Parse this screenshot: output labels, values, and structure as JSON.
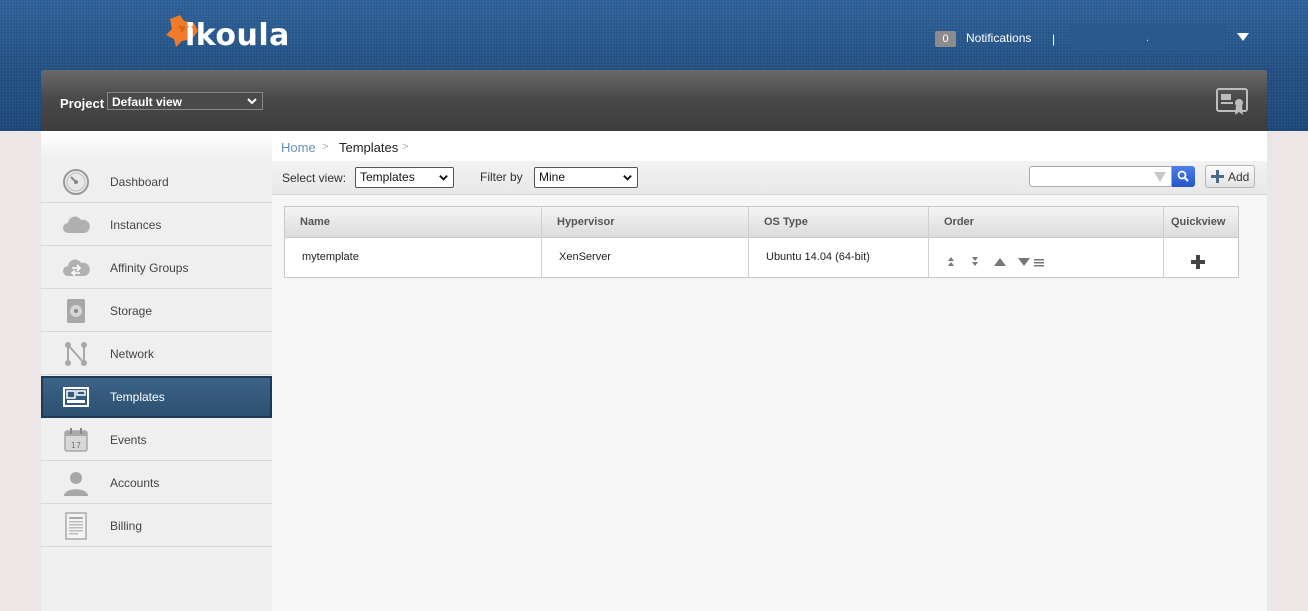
{
  "header": {
    "logo_text": "ikoula",
    "notifications": {
      "count": "0",
      "label": "Notifications",
      "separator": "|"
    },
    "user_name": "."
  },
  "toolbar": {
    "project_label": "Project",
    "project_selected": "Default view"
  },
  "sidebar": {
    "items": [
      {
        "label": "Dashboard",
        "icon": "dashboard-gauge-icon"
      },
      {
        "label": "Instances",
        "icon": "cloud-icon"
      },
      {
        "label": "Affinity Groups",
        "icon": "cloud-arrows-icon"
      },
      {
        "label": "Storage",
        "icon": "hard-disk-icon"
      },
      {
        "label": "Network",
        "icon": "network-nodes-icon"
      },
      {
        "label": "Templates",
        "icon": "templates-icon",
        "active": true
      },
      {
        "label": "Events",
        "icon": "calendar-icon"
      },
      {
        "label": "Accounts",
        "icon": "user-icon"
      },
      {
        "label": "Billing",
        "icon": "invoice-icon"
      }
    ]
  },
  "breadcrumb": {
    "home": "Home",
    "current": "Templates",
    "separator": ">"
  },
  "filters": {
    "select_view_label": "Select view:",
    "select_view_value": "Templates",
    "filter_by_label": "Filter by",
    "filter_by_value": "Mine",
    "search_value": "",
    "add_label": "Add"
  },
  "table": {
    "columns": [
      "Name",
      "Hypervisor",
      "OS Type",
      "Order",
      "Quickview"
    ],
    "rows": [
      {
        "name": "mytemplate",
        "hypervisor": "XenServer",
        "os_type": "Ubuntu 14.04 (64-bit)"
      }
    ]
  },
  "colors": {
    "header_blue": "#214f82",
    "active_nav": "#2c5070",
    "logo_orange": "#f07b2a",
    "link_blue": "#6a8fb8"
  }
}
